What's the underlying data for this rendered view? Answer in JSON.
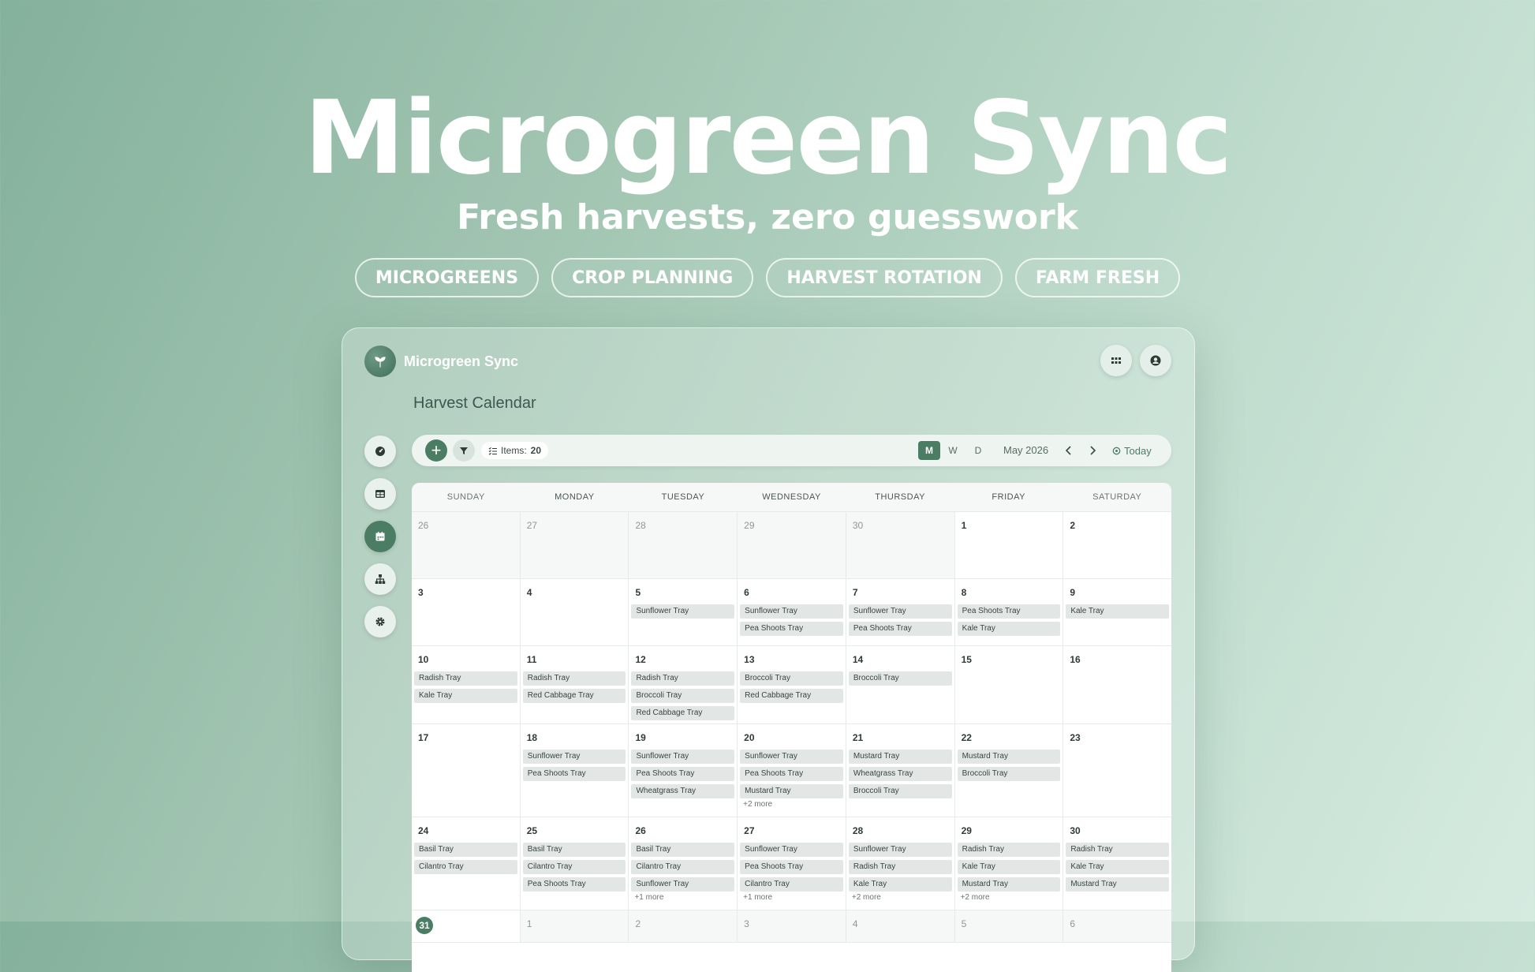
{
  "hero": {
    "title": "Microgreen Sync",
    "subtitle": "Fresh harvests, zero guesswork",
    "tags": [
      "MICROGREENS",
      "CROP PLANNING",
      "HARVEST ROTATION",
      "FARM FRESH"
    ]
  },
  "app": {
    "name": "Microgreen Sync",
    "page_title": "Harvest Calendar",
    "toolbar": {
      "add_label": "+",
      "items_label": "Items:",
      "items_count": "20",
      "views": [
        "M",
        "W",
        "D"
      ],
      "active_view": "M",
      "month_label": "May 2026",
      "today_label": "Today"
    },
    "sidebar": [
      "dashboard-icon",
      "table-icon",
      "calendar-icon",
      "hierarchy-icon",
      "gear-icon"
    ],
    "colors": {
      "accent": "#4b7d65",
      "event_bg": "#e2e6e4"
    }
  },
  "calendar": {
    "weekdays": [
      "SUNDAY",
      "MONDAY",
      "TUESDAY",
      "WEDNESDAY",
      "THURSDAY",
      "FRIDAY",
      "SATURDAY"
    ],
    "weeks": [
      [
        {
          "num": "26",
          "other": true,
          "events": []
        },
        {
          "num": "27",
          "other": true,
          "events": []
        },
        {
          "num": "28",
          "other": true,
          "events": []
        },
        {
          "num": "29",
          "other": true,
          "events": []
        },
        {
          "num": "30",
          "other": true,
          "events": []
        },
        {
          "num": "1",
          "events": []
        },
        {
          "num": "2",
          "events": []
        }
      ],
      [
        {
          "num": "3",
          "events": []
        },
        {
          "num": "4",
          "events": []
        },
        {
          "num": "5",
          "events": [
            "Sunflower Tray"
          ]
        },
        {
          "num": "6",
          "events": [
            "Sunflower Tray",
            "Pea Shoots Tray"
          ]
        },
        {
          "num": "7",
          "events": [
            "Sunflower Tray",
            "Pea Shoots Tray"
          ]
        },
        {
          "num": "8",
          "events": [
            "Pea Shoots Tray",
            "Kale Tray"
          ]
        },
        {
          "num": "9",
          "events": [
            "Kale Tray"
          ]
        }
      ],
      [
        {
          "num": "10",
          "events": [
            "Radish Tray",
            "Kale Tray"
          ]
        },
        {
          "num": "11",
          "events": [
            "Radish Tray",
            "Red Cabbage Tray"
          ]
        },
        {
          "num": "12",
          "events": [
            "Radish Tray",
            "Broccoli Tray",
            "Red Cabbage Tray"
          ]
        },
        {
          "num": "13",
          "events": [
            "Broccoli Tray",
            "Red Cabbage Tray"
          ]
        },
        {
          "num": "14",
          "events": [
            "Broccoli Tray"
          ]
        },
        {
          "num": "15",
          "events": []
        },
        {
          "num": "16",
          "events": []
        }
      ],
      [
        {
          "num": "17",
          "events": []
        },
        {
          "num": "18",
          "events": [
            "Sunflower Tray",
            "Pea Shoots Tray"
          ]
        },
        {
          "num": "19",
          "events": [
            "Sunflower Tray",
            "Pea Shoots Tray",
            "Wheatgrass Tray"
          ]
        },
        {
          "num": "20",
          "events": [
            "Sunflower Tray",
            "Pea Shoots Tray",
            "Mustard Tray"
          ],
          "more": "+2 more"
        },
        {
          "num": "21",
          "events": [
            "Mustard Tray",
            "Wheatgrass Tray",
            "Broccoli Tray"
          ]
        },
        {
          "num": "22",
          "events": [
            "Mustard Tray",
            "Broccoli Tray"
          ]
        },
        {
          "num": "23",
          "events": []
        }
      ],
      [
        {
          "num": "24",
          "events": [
            "Basil Tray",
            "Cilantro Tray"
          ]
        },
        {
          "num": "25",
          "events": [
            "Basil Tray",
            "Cilantro Tray",
            "Pea Shoots Tray"
          ]
        },
        {
          "num": "26",
          "events": [
            "Basil Tray",
            "Cilantro Tray",
            "Sunflower Tray"
          ],
          "more": "+1 more"
        },
        {
          "num": "27",
          "events": [
            "Sunflower Tray",
            "Pea Shoots Tray",
            "Cilantro Tray"
          ],
          "more": "+1 more"
        },
        {
          "num": "28",
          "events": [
            "Sunflower Tray",
            "Radish Tray",
            "Kale Tray"
          ],
          "more": "+2 more"
        },
        {
          "num": "29",
          "events": [
            "Radish Tray",
            "Kale Tray",
            "Mustard Tray"
          ],
          "more": "+2 more"
        },
        {
          "num": "30",
          "events": [
            "Radish Tray",
            "Kale Tray",
            "Mustard Tray"
          ]
        }
      ],
      [
        {
          "num": "31",
          "today": true,
          "events": []
        },
        {
          "num": "1",
          "other": true,
          "events": []
        },
        {
          "num": "2",
          "other": true,
          "events": []
        },
        {
          "num": "3",
          "other": true,
          "events": []
        },
        {
          "num": "4",
          "other": true,
          "events": []
        },
        {
          "num": "5",
          "other": true,
          "events": []
        },
        {
          "num": "6",
          "other": true,
          "events": []
        }
      ]
    ]
  }
}
